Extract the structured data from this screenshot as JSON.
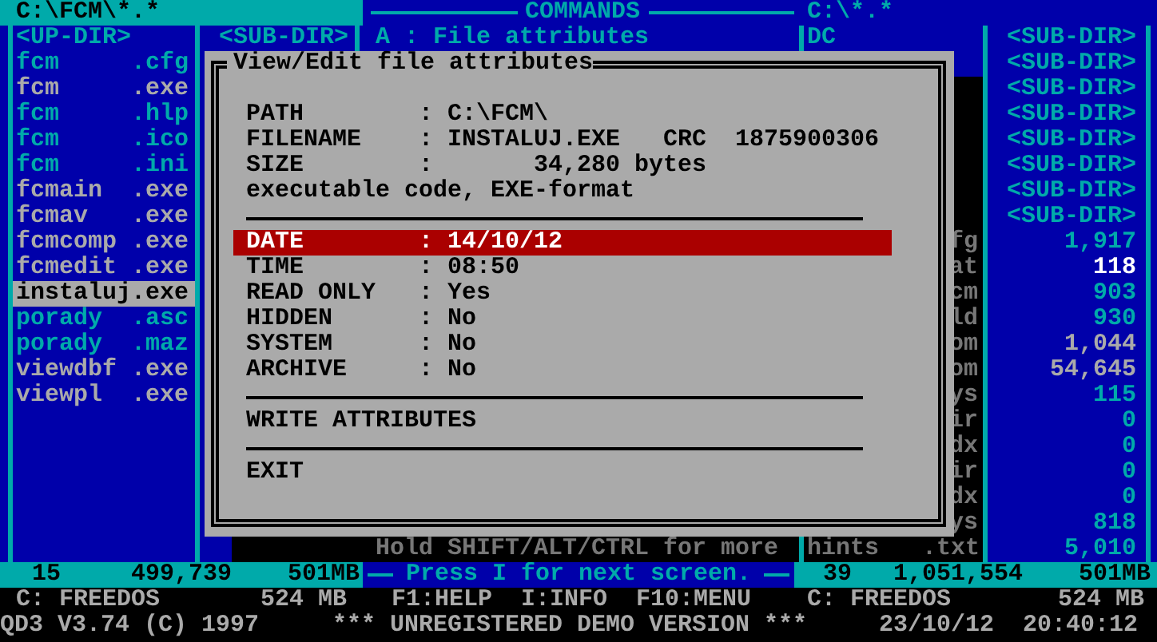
{
  "left_panel": {
    "title": "C:\\FCM\\*.*",
    "rows": [
      {
        "name": "<UP-DIR>",
        "size": "<SUB-DIR>",
        "kind": "dir",
        "selected": false
      },
      {
        "name": "fcm",
        "ext": ".cfg",
        "kind": "data",
        "selected": false
      },
      {
        "name": "fcm",
        "ext": ".exe",
        "kind": "exe",
        "selected": false
      },
      {
        "name": "fcm",
        "ext": ".hlp",
        "kind": "data",
        "selected": false
      },
      {
        "name": "fcm",
        "ext": ".ico",
        "kind": "data",
        "selected": false
      },
      {
        "name": "fcm",
        "ext": ".ini",
        "kind": "data",
        "selected": false
      },
      {
        "name": "fcmain",
        "ext": ".exe",
        "kind": "exe",
        "selected": false
      },
      {
        "name": "fcmav",
        "ext": ".exe",
        "kind": "exe",
        "selected": false
      },
      {
        "name": "fcmcomp",
        "ext": ".exe",
        "kind": "exe",
        "selected": false
      },
      {
        "name": "fcmedit",
        "ext": ".exe",
        "kind": "exe",
        "selected": false
      },
      {
        "name": "instaluj",
        "ext": ".exe",
        "kind": "exe",
        "selected": true
      },
      {
        "name": "porady",
        "ext": ".asc",
        "kind": "data",
        "selected": false
      },
      {
        "name": "porady",
        "ext": ".maz",
        "kind": "data",
        "selected": false
      },
      {
        "name": "viewdbf",
        "ext": ".exe",
        "kind": "exe",
        "selected": false
      },
      {
        "name": "viewpl",
        "ext": ".exe",
        "kind": "exe",
        "selected": false
      }
    ]
  },
  "commands_panel": {
    "title": "COMMANDS",
    "first_item": "A : File attributes",
    "hint": "Hold SHIFT/ALT/CTRL for more"
  },
  "right_panel": {
    "title": "C:\\*.*",
    "rows": [
      {
        "name": "DC",
        "size": "<SUB-DIR>",
        "kind": "dir"
      },
      {
        "size": "<SUB-DIR>",
        "kind": "dir"
      },
      {
        "size": "<SUB-DIR>",
        "kind": "dir"
      },
      {
        "size": "<SUB-DIR>",
        "kind": "dir"
      },
      {
        "size": "<SUB-DIR>",
        "kind": "dir"
      },
      {
        "size": "<SUB-DIR>",
        "kind": "dir"
      },
      {
        "size": "<SUB-DIR>",
        "kind": "dir"
      },
      {
        "size": "<SUB-DIR>",
        "kind": "dir"
      },
      {
        "name_tail": "fg",
        "size": "1,917",
        "kind": "data"
      },
      {
        "name_tail": "at",
        "size": "118",
        "kind": "marked"
      },
      {
        "name_tail": "cm",
        "size": "903",
        "kind": "data"
      },
      {
        "name_tail": "ld",
        "size": "930",
        "kind": "data"
      },
      {
        "name_tail": "om",
        "size": "1,044",
        "kind": "exe"
      },
      {
        "name_tail": "om",
        "size": "54,645",
        "kind": "exe"
      },
      {
        "name_tail": "ys",
        "size": "115",
        "kind": "data"
      },
      {
        "name_tail": "ir",
        "size": "0",
        "kind": "data"
      },
      {
        "name_tail": "dx",
        "size": "0",
        "kind": "data"
      },
      {
        "name_tail": "ir",
        "size": "0",
        "kind": "data"
      },
      {
        "name_tail": "dx",
        "size": "0",
        "kind": "data"
      },
      {
        "name_tail": "ys",
        "size": "818",
        "kind": "data"
      },
      {
        "name": "hints",
        "ext": ".txt",
        "size": "5,010",
        "kind": "data"
      }
    ]
  },
  "dialog": {
    "title": "View/Edit file attributes",
    "separator": ":",
    "info": [
      {
        "label": "PATH",
        "value": "C:\\FCM\\"
      },
      {
        "label": "FILENAME",
        "value": "INSTALUJ.EXE",
        "crc_label": "CRC",
        "crc": "1875900306"
      },
      {
        "label": "SIZE",
        "value": "34,280",
        "unit": "bytes"
      }
    ],
    "file_type": "executable code, EXE-format",
    "attributes": [
      {
        "label": "DATE",
        "value": "14/10/12",
        "selected": true
      },
      {
        "label": "TIME",
        "value": "08:50",
        "selected": false
      },
      {
        "label": "READ ONLY",
        "value": "Yes",
        "selected": false
      },
      {
        "label": "HIDDEN",
        "value": "No",
        "selected": false
      },
      {
        "label": "SYSTEM",
        "value": "No",
        "selected": false
      },
      {
        "label": "ARCHIVE",
        "value": "No",
        "selected": false
      }
    ],
    "actions": [
      {
        "label": "WRITE ATTRIBUTES",
        "selected": false
      },
      {
        "label": "EXIT",
        "selected": false
      }
    ]
  },
  "status": {
    "left": {
      "files": "15",
      "bytes": "499,739",
      "free": "501MB"
    },
    "message": "Press I for next screen.",
    "right": {
      "files": "39",
      "bytes": "1,051,554",
      "free": "501MB"
    }
  },
  "info_bar": {
    "drive_left": "C: FREEDOS",
    "size_left": "524 MB",
    "keys": [
      "F1:HELP",
      "I:INFO",
      "F10:MENU"
    ],
    "drive_right": "C: FREEDOS",
    "size_right": "524 MB"
  },
  "version_bar": {
    "program": "QD3 V3.74 (C) 1997",
    "notice": "*** UNREGISTERED DEMO VERSION ***",
    "date": "23/10/12",
    "time": "20:40:12"
  }
}
